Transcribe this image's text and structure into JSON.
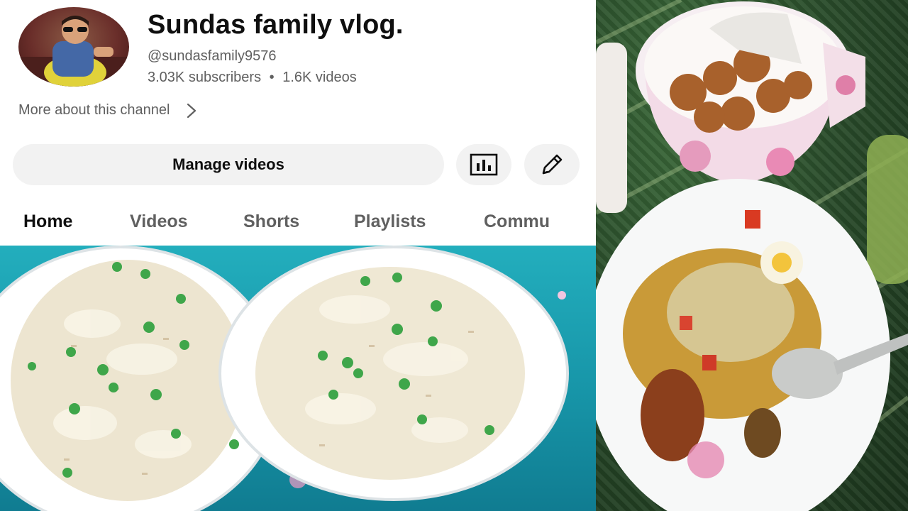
{
  "channel": {
    "title": "Sundas family vlog.",
    "handle": "@sundasfamily9576",
    "subscribers": "3.03K subscribers",
    "separator": "•",
    "videos": "1.6K videos"
  },
  "more_about": {
    "label": "More about this channel",
    "icon": "chevron-right-icon"
  },
  "actions": {
    "manage_videos_label": "Manage videos",
    "analytics_icon": "analytics-icon",
    "edit_icon": "pencil-icon"
  },
  "tabs": [
    {
      "label": "Home",
      "active": true
    },
    {
      "label": "Videos",
      "active": false
    },
    {
      "label": "Shorts",
      "active": false
    },
    {
      "label": "Playlists",
      "active": false
    },
    {
      "label": "Commu",
      "active": false
    }
  ],
  "colors": {
    "text_primary": "#0f0f0f",
    "text_secondary": "#606060",
    "button_bg": "#f2f2f2",
    "panel_bg": "#ffffff"
  }
}
